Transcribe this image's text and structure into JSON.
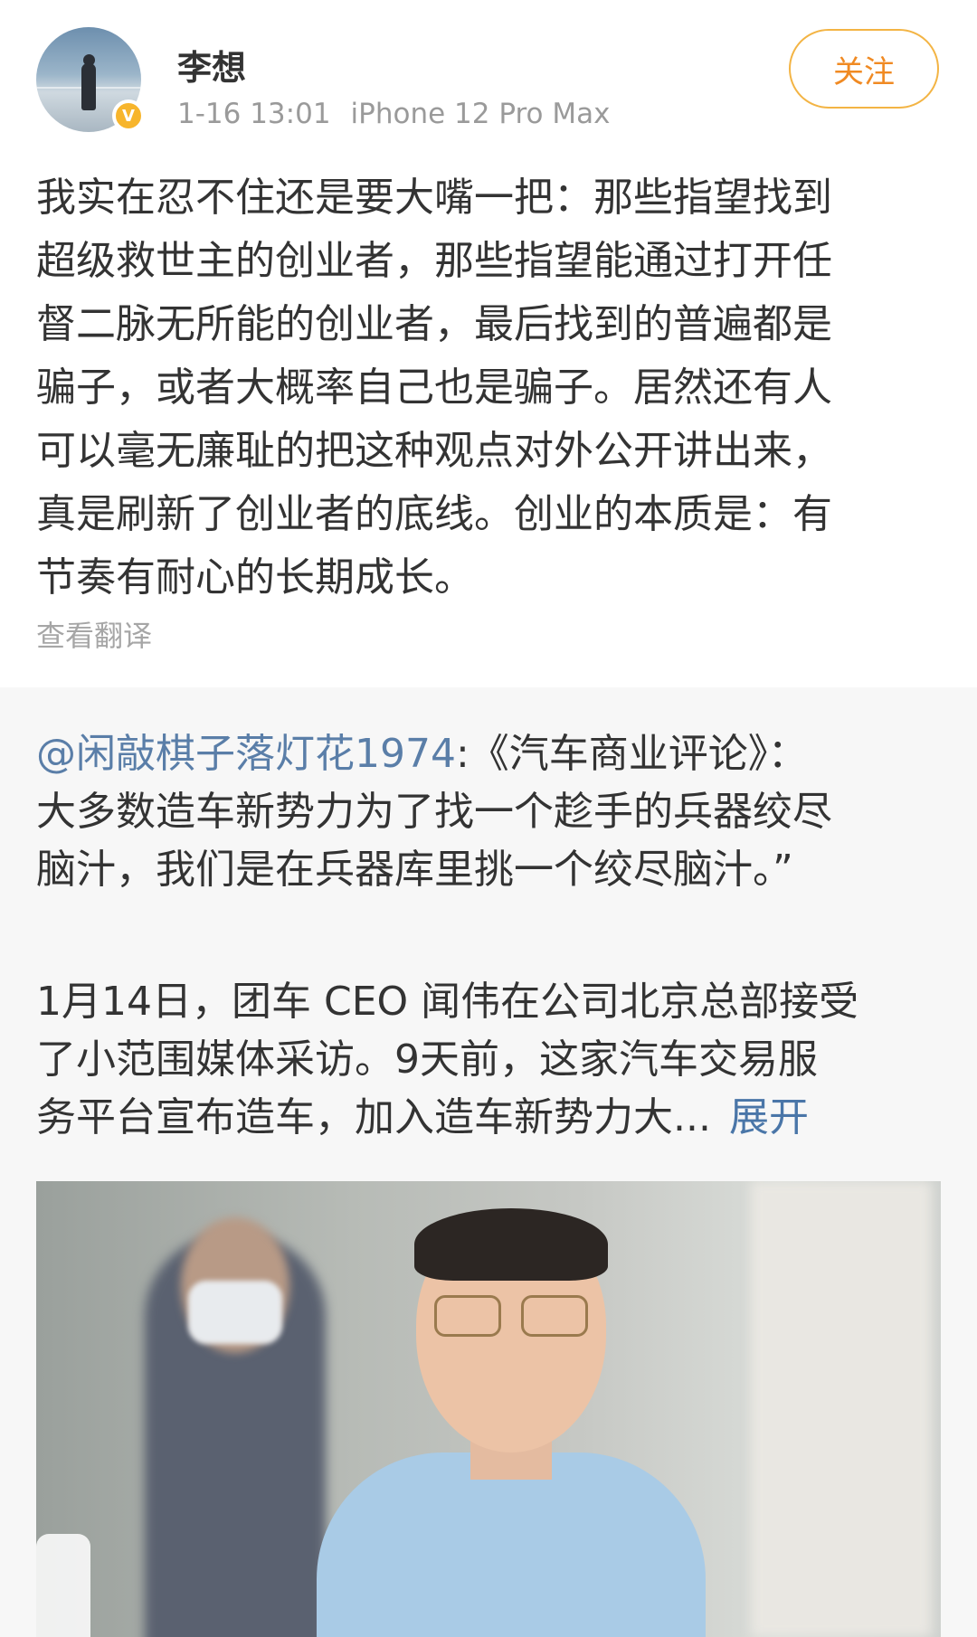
{
  "post": {
    "username": "李想",
    "timestamp": "1-16 13:01",
    "device": "iPhone 12 Pro Max",
    "follow_label": "关注",
    "verified_badge": "V",
    "text_lines": [
      "我实在忍不住还是要大嘴一把：那些指望找到",
      "超级救世主的创业者，那些指望能通过打开任",
      "督二脉无所能的创业者，最后找到的普遍都是",
      "骗子，或者大概率自己也是骗子。居然还有人",
      "可以毫无廉耻的把这种观点对外公开讲出来，",
      "真是刷新了创业者的底线。创业的本质是：有",
      "节奏有耐心的长期成长。"
    ],
    "translate_label": "查看翻译"
  },
  "repost": {
    "mention": "@闲敲棋子落灯花1974",
    "quote_line1_rest": ":《汽车商业评论》：",
    "quote_line2": "大多数造车新势力为了找一个趁手的兵器绞尽",
    "quote_line3": "脑汁，我们是在兵器库里挑一个绞尽脑汁。”",
    "body_line1": "1月14日，团车 CEO 闻伟在公司北京总部接受",
    "body_line2": "了小范围媒体采访。9天前，这家汽车交易服",
    "body_line3": "务平台宣布造车，加入造车新势力大...",
    "expand_label": "展开"
  },
  "colors": {
    "follow_border": "#f3b444",
    "follow_text": "#f08a23",
    "mention": "#5a7ea8",
    "expand": "#4a76a8",
    "verified": "#f7b52c",
    "repost_bg": "#f7f7f7"
  },
  "icons": {
    "avatar": "user-avatar",
    "verified": "verified-badge-icon"
  }
}
